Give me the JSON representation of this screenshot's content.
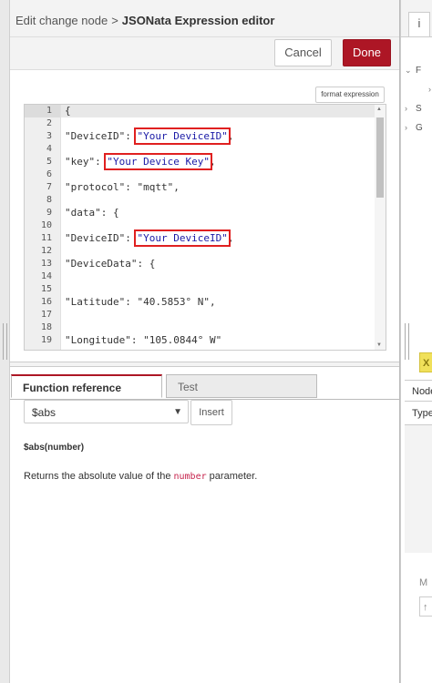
{
  "header": {
    "parent_crumb": "Edit change node",
    "separator": ">",
    "current_crumb": "JSONata Expression editor"
  },
  "toolbar": {
    "cancel_label": "Cancel",
    "done_label": "Done"
  },
  "editor": {
    "format_label": "format expression",
    "line_numbers": [
      "1",
      "2",
      "3",
      "4",
      "5",
      "6",
      "7",
      "8",
      "9",
      "10",
      "11",
      "12",
      "13",
      "14",
      "15",
      "16",
      "17",
      "18",
      "19"
    ],
    "lines": {
      "l1": "{",
      "l3_key": "\"DeviceID\": ",
      "l3_val": "\"Your DeviceID\"",
      "l3_end": ",",
      "l5_key": "\"key\": ",
      "l5_val": "\"Your Device Key\"",
      "l5_end": ",",
      "l7": "\"protocol\": \"mqtt\",",
      "l9": "\"data\": {",
      "l11_key": "\"DeviceID\": ",
      "l11_val": "\"Your DeviceID\"",
      "l11_end": ",",
      "l13": "\"DeviceData\": {",
      "l16": "\"Latitude\": \"40.5853° N\",",
      "l19": "\"Longitude\": \"105.0844° W\""
    }
  },
  "reference": {
    "tabs": [
      "Function reference",
      "Test"
    ],
    "selected_function": "$abs",
    "insert_label": "Insert",
    "signature": "$abs(number)",
    "description_before": "Returns the absolute value of the ",
    "description_code": "number",
    "description_after": " parameter."
  },
  "sidebar": {
    "info_icon_glyph": "i",
    "tree_rows": [
      {
        "chevron": "⌄",
        "label": "F"
      },
      {
        "chevron": "›",
        "label": ""
      },
      {
        "chevron": "›",
        "label": "S"
      },
      {
        "chevron": "›",
        "label": "G"
      }
    ],
    "row_extra": "›",
    "yellow_label": "X",
    "table_head": "Node",
    "table_row": "Type",
    "m_label": "M",
    "box_label": "↑"
  },
  "colors": {
    "accent": "#ad1625",
    "highlight_box": "#e02020"
  }
}
